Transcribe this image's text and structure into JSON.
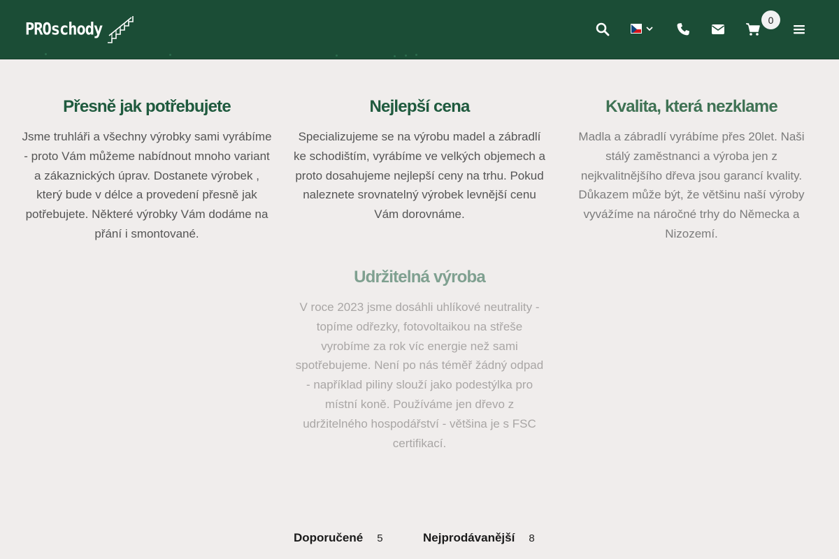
{
  "header": {
    "logo_text": "PROschody",
    "cart_count": "0",
    "icons": [
      "search-icon",
      "czech-flag-icon",
      "chevron-down-icon",
      "phone-icon",
      "envelope-icon",
      "cart-icon",
      "menu-icon"
    ],
    "colors": {
      "bar": "#1b4d36",
      "icon": "#ffffff",
      "badge": "#f2f2f2"
    }
  },
  "features": [
    {
      "title": "Přesně jak potřebujete",
      "text": "Jsme truhláři a všechny výrobky sami vyrábíme - proto Vám můžeme nabídnout mnoho variant a zákaznických úprav. Dostanete výrobek , který bude v délce a provedení přesně jak potřebujete. Některé výrobky Vám dodáme na přání i smontované."
    },
    {
      "title": "Nejlepší cena",
      "text": "Specializujeme se na výrobu madel a zábradlí ke schodištím, vyrábíme ve velkých objemech a proto dosahujeme nejlepší ceny na trhu. Pokud naleznete srovnatelný výrobek levnější cenu Vám dorovnáme."
    },
    {
      "title": "Kvalita, která nezklame",
      "text": "Madla a zábradlí vyrábíme přes 20let. Naši stálý zaměstnanci a výroba jen z nejkvalitnějšího dřeva jsou garancí kvality. Důkazem může být, že většinu naší výroby vyvážíme na náročné trhy do Německa a Nizozemí."
    },
    {
      "title": "Udržitelná výroba",
      "text": "V roce 2023 jsme dosáhli uhlíkové neutrality - topíme odřezky, fotovoltaikou na střeše vyrobíme za rok víc energie než sami spotřebujeme. Není po nás téměř žádný odpad - například piliny slouží jako podestýlka pro místní koně. Používáme jen dřevo z udržitelného hospodářství - většina je s FSC certifikací."
    }
  ],
  "tabs": [
    {
      "label": "Doporučené",
      "count": "5"
    },
    {
      "label": "Nejprodávanější",
      "count": "8"
    }
  ]
}
